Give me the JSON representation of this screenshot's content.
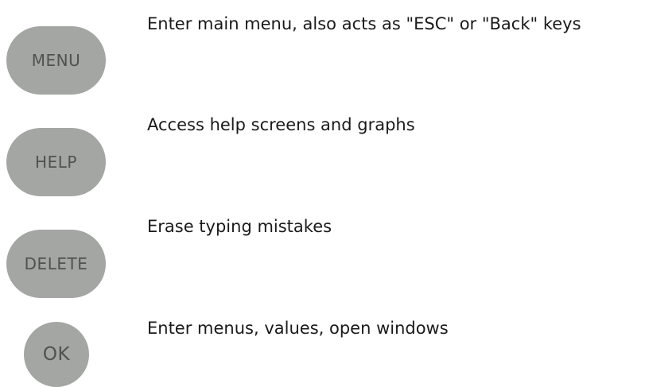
{
  "keys": [
    {
      "label": "MENU",
      "description": "Enter main menu, also acts as \"ESC\" or \"Back\" keys"
    },
    {
      "label": "HELP",
      "description": "Access help screens and graphs"
    },
    {
      "label": "DELETE",
      "description": "Erase typing mistakes"
    },
    {
      "label": "OK",
      "description": "Enter menus, values, open windows"
    }
  ],
  "colors": {
    "key_fill": "#a4a6a4",
    "key_text": "#505250",
    "description_text": "#1a1a1a"
  }
}
